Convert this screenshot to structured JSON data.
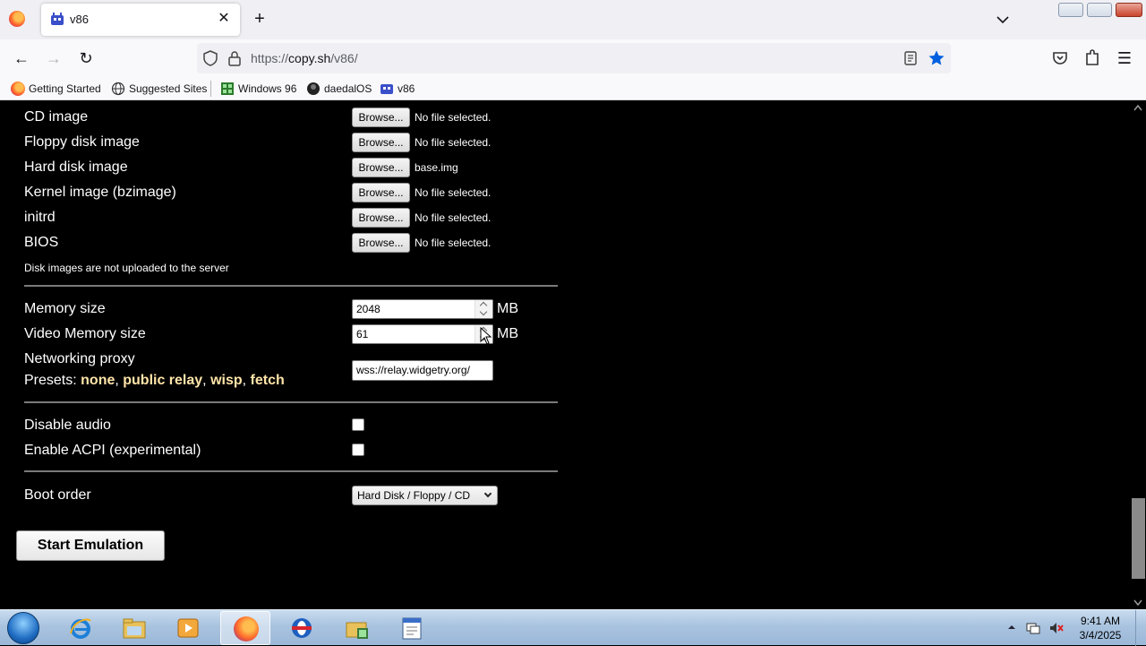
{
  "browser": {
    "tab_title": "v86",
    "url_prefix": "https://",
    "url_host": "copy.sh",
    "url_path": "/v86/",
    "bookmarks": [
      "Getting Started",
      "Suggested Sites",
      "Windows 96",
      "daedalOS",
      "v86"
    ]
  },
  "form": {
    "files": [
      {
        "label": "CD image",
        "button": "Browse...",
        "status": "No file selected."
      },
      {
        "label": "Floppy disk image",
        "button": "Browse...",
        "status": "No file selected."
      },
      {
        "label": "Hard disk image",
        "button": "Browse...",
        "status": "base.img"
      },
      {
        "label": "Kernel image (bzimage)",
        "button": "Browse...",
        "status": "No file selected."
      },
      {
        "label": "initrd",
        "button": "Browse...",
        "status": "No file selected."
      },
      {
        "label": "BIOS",
        "button": "Browse...",
        "status": "No file selected."
      }
    ],
    "disk_note": "Disk images are not uploaded to the server",
    "memory_label": "Memory size",
    "memory_value": "2048",
    "memory_unit": "MB",
    "video_memory_label": "Video Memory size",
    "video_memory_value": "61",
    "video_memory_unit": "MB",
    "proxy_label": "Networking proxy",
    "presets_label": "Presets: ",
    "presets": [
      "none",
      "public relay",
      "wisp",
      "fetch"
    ],
    "preset_separator": ", ",
    "proxy_value": "wss://relay.widgetry.org/",
    "disable_audio_label": "Disable audio",
    "disable_audio_checked": false,
    "acpi_label": "Enable ACPI (experimental)",
    "acpi_checked": false,
    "boot_order_label": "Boot order",
    "boot_order_value": "Hard Disk / Floppy / CD",
    "start_button": "Start Emulation"
  },
  "taskbar": {
    "time": "9:41 AM",
    "date": "3/4/2025"
  },
  "colors": {
    "page_bg": "#000000",
    "preset_link": "#ffe4a8",
    "bookmark_star": "#0060df"
  },
  "icons": [
    "firefox-icon",
    "v86-icon",
    "close-icon",
    "plus-icon",
    "back-arrow-icon",
    "forward-arrow-icon",
    "reload-icon",
    "shield-icon",
    "lock-icon",
    "reader-view-icon",
    "star-icon",
    "pocket-icon",
    "extensions-icon",
    "hamburger-menu-icon",
    "globe-icon",
    "windows96-icon",
    "daedalos-icon",
    "mouse-cursor-icon",
    "windows-start-icon",
    "internet-explorer-icon",
    "file-explorer-icon",
    "media-player-icon",
    "opera-icon",
    "folder-icon",
    "notepad-icon",
    "network-icon",
    "volume-muted-icon"
  ]
}
